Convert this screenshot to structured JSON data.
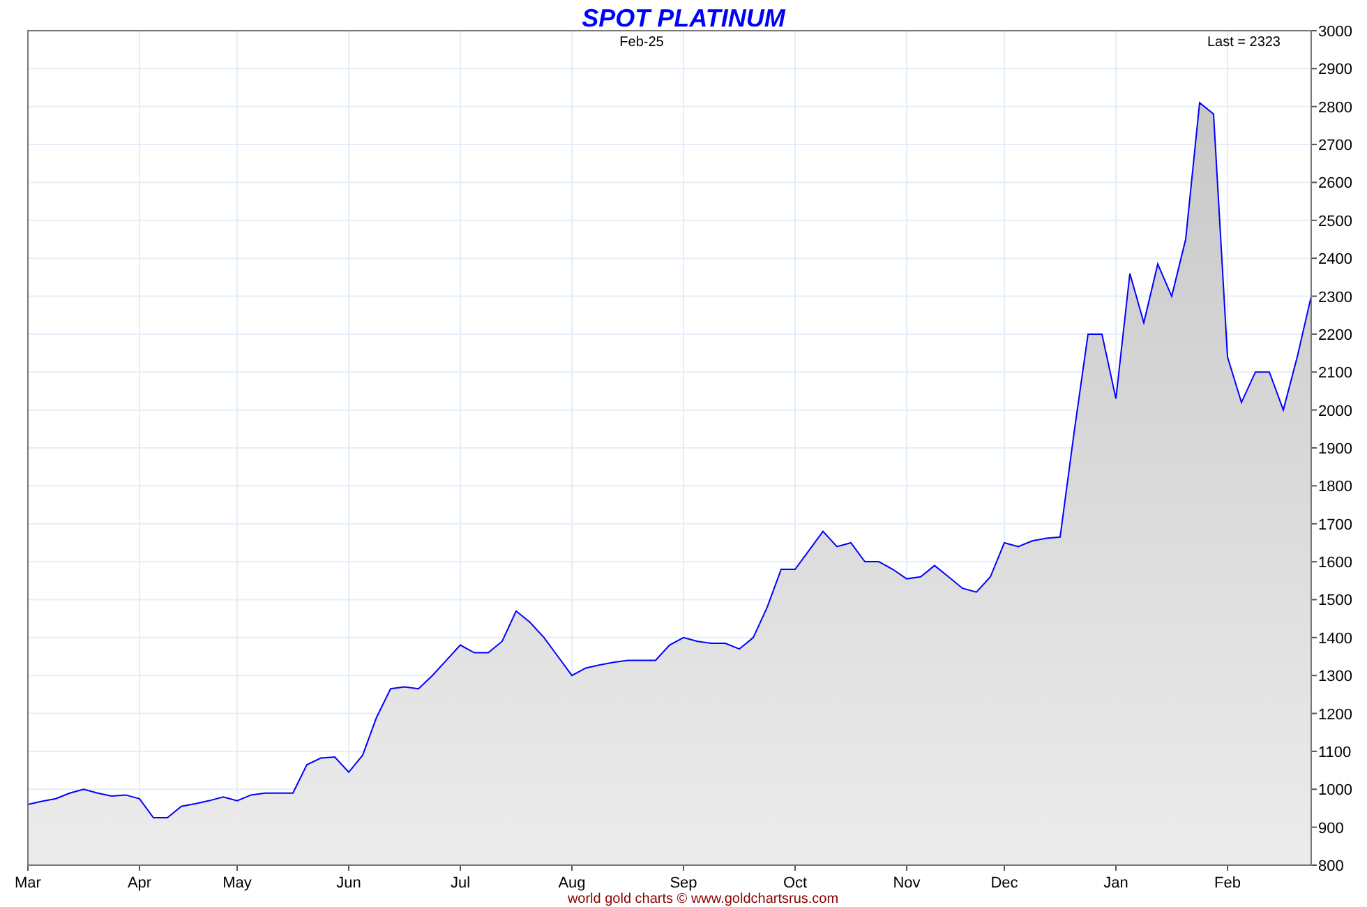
{
  "title": "SPOT PLATINUM",
  "period": "Feb-25",
  "last_value": "Last = 2323",
  "footer": "world gold charts © www.goldchartsrus.com",
  "chart_data": {
    "type": "area",
    "grid": true,
    "ylim": [
      800,
      3000
    ],
    "categories": [
      "Mar",
      null,
      null,
      null,
      null,
      null,
      null,
      null,
      "Apr",
      null,
      null,
      null,
      null,
      null,
      null,
      "May",
      null,
      null,
      null,
      null,
      null,
      null,
      null,
      "Jun",
      null,
      null,
      null,
      null,
      null,
      null,
      null,
      "Jul",
      null,
      null,
      null,
      null,
      null,
      null,
      null,
      "Aug",
      null,
      null,
      null,
      null,
      null,
      null,
      null,
      "Sep",
      null,
      null,
      null,
      null,
      null,
      null,
      null,
      "Oct",
      null,
      null,
      null,
      null,
      null,
      null,
      null,
      "Nov",
      null,
      null,
      null,
      null,
      null,
      null,
      "Dec",
      null,
      null,
      null,
      null,
      null,
      null,
      null,
      "Jan",
      null,
      null,
      null,
      null,
      null,
      null,
      null,
      "Feb",
      null,
      null,
      null,
      null,
      null,
      null
    ],
    "yticks": [
      800,
      900,
      1000,
      1100,
      1200,
      1300,
      1400,
      1500,
      1600,
      1700,
      1800,
      1900,
      2000,
      2100,
      2200,
      2300,
      2400,
      2500,
      2600,
      2700,
      2800,
      2900,
      3000
    ],
    "series": [
      {
        "color": "#0000ff",
        "values": [
          960,
          968,
          975,
          990,
          1000,
          990,
          982,
          985,
          975,
          925,
          925,
          955,
          962,
          970,
          980,
          970,
          985,
          990,
          990,
          990,
          1065,
          1082,
          1085,
          1045,
          1090,
          1190,
          1265,
          1270,
          1265,
          1300,
          1340,
          1380,
          1360,
          1360,
          1390,
          1470,
          1440,
          1400,
          1350,
          1300,
          1320,
          1328,
          1335,
          1340,
          1340,
          1340,
          1380,
          1400,
          1390,
          1385,
          1385,
          1370,
          1400,
          1480,
          1580,
          1580,
          1630,
          1680,
          1640,
          1650,
          1600,
          1600,
          1580,
          1555,
          1560,
          1590,
          1560,
          1530,
          1520,
          1560,
          1650,
          1640,
          1655,
          1662,
          1665,
          1940,
          2200,
          2200,
          2030,
          2360,
          2230,
          2385,
          2300,
          2450,
          2810,
          2780,
          2140,
          2020,
          2100,
          2100,
          2000,
          2140,
          2300
        ]
      }
    ]
  }
}
